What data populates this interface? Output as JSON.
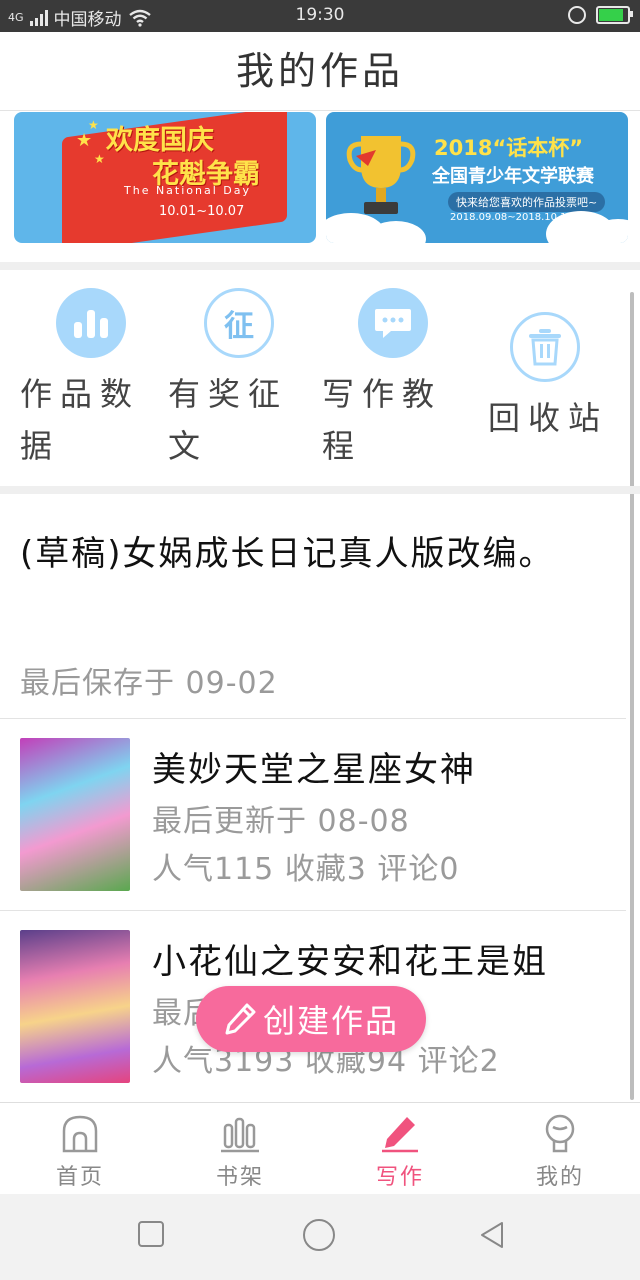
{
  "status_bar": {
    "network": "4G",
    "carrier": "中国移动",
    "time": "19:30",
    "battery_level": 0.8
  },
  "header": {
    "title": "我的作品"
  },
  "banners": [
    {
      "title_line1": "欢度国庆",
      "title_line2": "花魁争霸",
      "subtitle": "The National Day",
      "date": "10.01~10.07"
    },
    {
      "title": "2018“话本杯”",
      "subtitle": "全国青少年文学联赛",
      "tagline": "快来给您喜欢的作品投票吧~",
      "date": "2018.09.08~2018.10.14"
    }
  ],
  "quick_actions": [
    {
      "label": "作品数据",
      "icon": "bar-chart-icon"
    },
    {
      "label": "有奖征文",
      "icon": "contest-icon",
      "icon_text": "征"
    },
    {
      "label": "写作教程",
      "icon": "chat-bubble-icon"
    },
    {
      "label": "回收站",
      "icon": "trash-icon"
    }
  ],
  "draft": {
    "title": "(草稿)女娲成长日记真人版改编。",
    "meta": "最后保存于 09-02"
  },
  "works": [
    {
      "title": "美妙天堂之星座女神",
      "updated": "最后更新于 08-08",
      "stats": "人气115 收藏3 评论0"
    },
    {
      "title": "小花仙之安安和花王是姐",
      "updated": "最后更新于 08-03",
      "stats": "人气3193 收藏94 评论2"
    }
  ],
  "fab": {
    "label": "创建作品"
  },
  "tabs": [
    {
      "label": "首页",
      "icon": "home-icon"
    },
    {
      "label": "书架",
      "icon": "bookshelf-icon"
    },
    {
      "label": "写作",
      "icon": "pencil-icon",
      "active": true
    },
    {
      "label": "我的",
      "icon": "profile-icon"
    }
  ],
  "colors": {
    "accent": "#f0537e",
    "fab": "#f76a9c",
    "icon_blue": "#a8d8fb"
  }
}
